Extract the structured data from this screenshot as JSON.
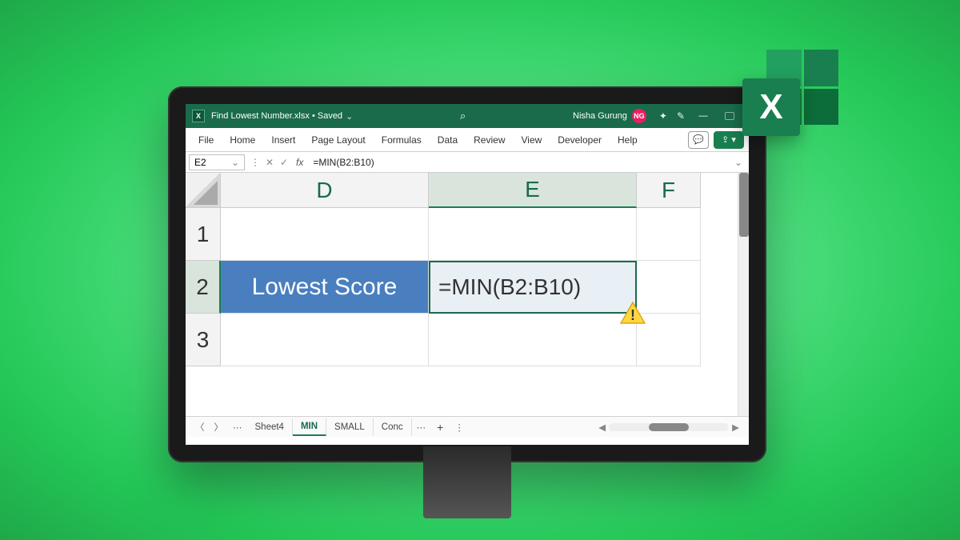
{
  "titlebar": {
    "filename": "Find Lowest Number.xlsx",
    "saved_state": "Saved",
    "user_name": "Nisha Gurung",
    "user_initials": "NG"
  },
  "ribbon": {
    "tabs": [
      "File",
      "Home",
      "Insert",
      "Page Layout",
      "Formulas",
      "Data",
      "Review",
      "View",
      "Developer",
      "Help"
    ]
  },
  "formula_bar": {
    "cell_ref": "E2",
    "formula": "=MIN(B2:B10)"
  },
  "grid": {
    "columns": [
      "D",
      "E",
      "F"
    ],
    "rows": [
      "1",
      "2",
      "3"
    ],
    "cells": {
      "D2": "Lowest Score",
      "E2": "=MIN(B2:B10)"
    }
  },
  "sheet_tabs": {
    "tabs": [
      "Sheet4",
      "MIN",
      "SMALL",
      "Conc"
    ],
    "active": "MIN"
  },
  "excel_logo": "X"
}
